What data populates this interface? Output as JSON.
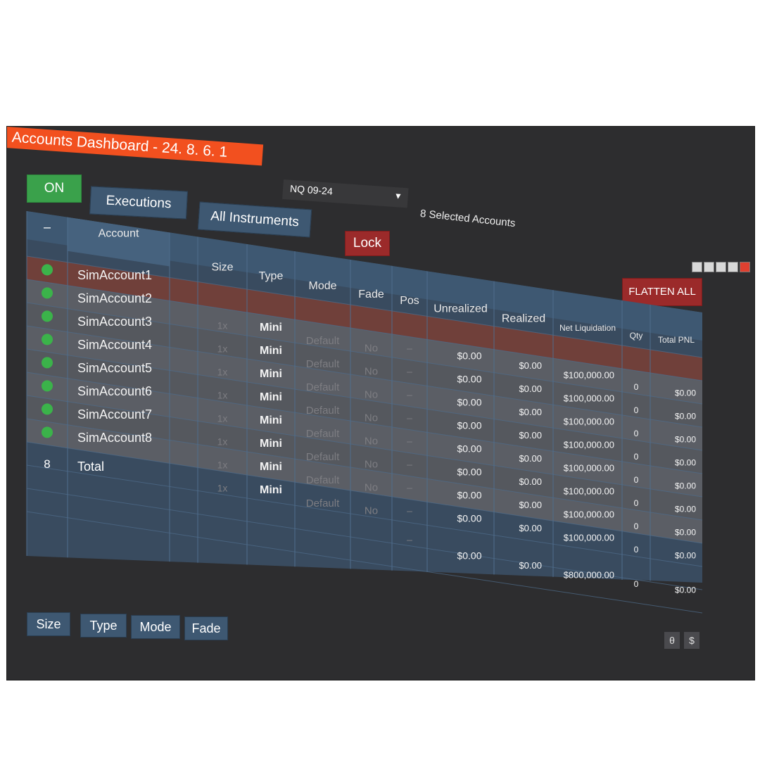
{
  "window": {
    "title": "Accounts Dashboard - 24. 8. 6. 1"
  },
  "toolbar": {
    "on_label": "ON",
    "executions_label": "Executions",
    "instruments_label": "All Instruments",
    "lock_label": "Lock",
    "instrument_value": "NQ 09-24",
    "selected_accounts": "8 Selected Accounts",
    "flatten_label": "FLATTEN ALL",
    "collapse_label": "–"
  },
  "columns": [
    "Account",
    "Size",
    "Type",
    "Mode",
    "Fade",
    "Pos",
    "Unrealized",
    "Realized",
    "Net Liquidation",
    "Qty",
    "Total PNL"
  ],
  "rows": [
    {
      "account": "SimAccount1",
      "size": "1x",
      "type": "Mini",
      "mode": "Default",
      "fade": "No",
      "pos": "–",
      "unrealized": "$0.00",
      "realized": "$0.00",
      "net": "$100,000.00",
      "qty": "0",
      "pnl": "$0.00"
    },
    {
      "account": "SimAccount2",
      "size": "1x",
      "type": "Mini",
      "mode": "Default",
      "fade": "No",
      "pos": "–",
      "unrealized": "$0.00",
      "realized": "$0.00",
      "net": "$100,000.00",
      "qty": "0",
      "pnl": "$0.00"
    },
    {
      "account": "SimAccount3",
      "size": "1x",
      "type": "Mini",
      "mode": "Default",
      "fade": "No",
      "pos": "–",
      "unrealized": "$0.00",
      "realized": "$0.00",
      "net": "$100,000.00",
      "qty": "0",
      "pnl": "$0.00"
    },
    {
      "account": "SimAccount4",
      "size": "1x",
      "type": "Mini",
      "mode": "Default",
      "fade": "No",
      "pos": "–",
      "unrealized": "$0.00",
      "realized": "$0.00",
      "net": "$100,000.00",
      "qty": "0",
      "pnl": "$0.00"
    },
    {
      "account": "SimAccount5",
      "size": "1x",
      "type": "Mini",
      "mode": "Default",
      "fade": "No",
      "pos": "–",
      "unrealized": "$0.00",
      "realized": "$0.00",
      "net": "$100,000.00",
      "qty": "0",
      "pnl": "$0.00"
    },
    {
      "account": "SimAccount6",
      "size": "1x",
      "type": "Mini",
      "mode": "Default",
      "fade": "No",
      "pos": "–",
      "unrealized": "$0.00",
      "realized": "$0.00",
      "net": "$100,000.00",
      "qty": "0",
      "pnl": "$0.00"
    },
    {
      "account": "SimAccount7",
      "size": "1x",
      "type": "Mini",
      "mode": "Default",
      "fade": "No",
      "pos": "–",
      "unrealized": "$0.00",
      "realized": "$0.00",
      "net": "$100,000.00",
      "qty": "0",
      "pnl": "$0.00"
    },
    {
      "account": "SimAccount8",
      "size": "1x",
      "type": "Mini",
      "mode": "Default",
      "fade": "No",
      "pos": "–",
      "unrealized": "$0.00",
      "realized": "$0.00",
      "net": "$100,000.00",
      "qty": "0",
      "pnl": "$0.00"
    }
  ],
  "total": {
    "count": "8",
    "label": "Total",
    "pos": "–",
    "unrealized": "$0.00",
    "realized": "$0.00",
    "net": "$800,000.00",
    "qty": "0",
    "pnl": "$0.00"
  },
  "bottom_buttons": [
    "Size",
    "Type",
    "Mode",
    "Fade"
  ],
  "small_buttons": [
    "θ",
    "$"
  ],
  "colors": {
    "accent": "#f2501f",
    "on": "#3aa14b",
    "danger": "#9b2a2a",
    "header": "#3e5872",
    "status": "#3bb34a"
  }
}
